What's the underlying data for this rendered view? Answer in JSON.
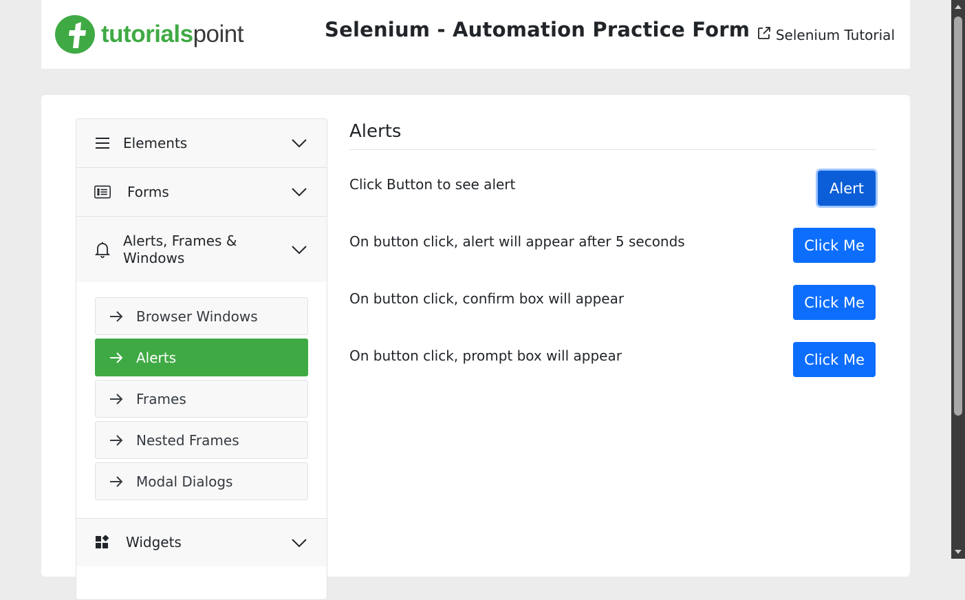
{
  "header": {
    "logo_text_bold": "tutorials",
    "logo_text_light": "point",
    "title": "Selenium - Automation Practice Form",
    "tutorial_link": "Selenium Tutorial"
  },
  "sidebar": {
    "sections": [
      {
        "label": "Elements",
        "icon": "hamburger-menu-icon"
      },
      {
        "label": "Forms",
        "icon": "list-form-icon"
      },
      {
        "label": "Alerts, Frames & Windows",
        "icon": "bell-icon"
      },
      {
        "label": "Widgets",
        "icon": "widgets-grid-icon"
      }
    ],
    "sub_items": [
      {
        "label": "Browser Windows",
        "active": false
      },
      {
        "label": "Alerts",
        "active": true
      },
      {
        "label": "Frames",
        "active": false
      },
      {
        "label": "Nested Frames",
        "active": false
      },
      {
        "label": "Modal Dialogs",
        "active": false
      }
    ]
  },
  "content": {
    "section_title": "Alerts",
    "rows": [
      {
        "text": "Click Button to see alert",
        "button": "Alert"
      },
      {
        "text": "On button click, alert will appear after 5 seconds",
        "button": "Click Me"
      },
      {
        "text": "On button click, confirm box will appear",
        "button": "Click Me"
      },
      {
        "text": "On button click, prompt box will appear",
        "button": "Click Me"
      }
    ]
  },
  "colors": {
    "brand_green": "#3faa44",
    "primary_blue": "#0d6efd",
    "page_background": "#ececec"
  }
}
